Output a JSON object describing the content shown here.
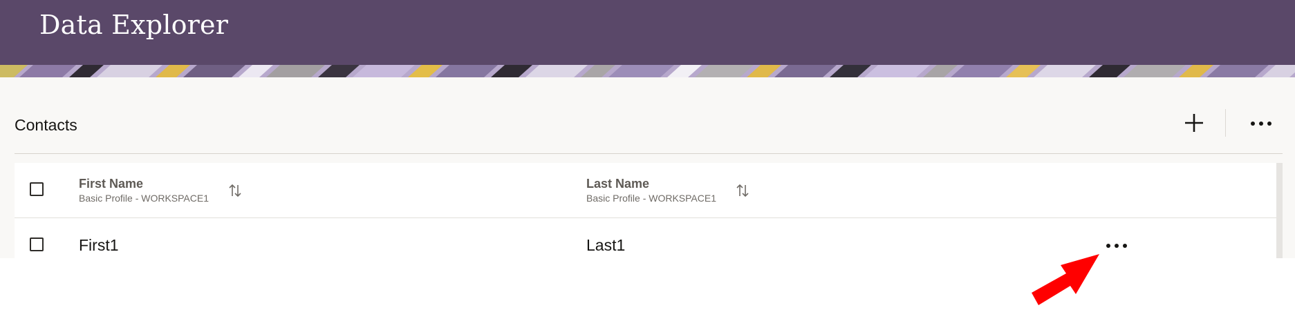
{
  "app": {
    "title": "Data Explorer"
  },
  "section": {
    "title": "Contacts"
  },
  "toolbar": {
    "add_icon": "plus-icon",
    "more_icon": "ellipsis-icon"
  },
  "table": {
    "columns": [
      {
        "title": "First Name",
        "subtitle": "Basic Profile - WORKSPACE1"
      },
      {
        "title": "Last Name",
        "subtitle": "Basic Profile - WORKSPACE1"
      }
    ],
    "rows": [
      {
        "first_name": "First1",
        "last_name": "Last1"
      }
    ]
  },
  "colors": {
    "header_bg": "#5a4869",
    "panel_bg": "#f9f8f6",
    "annotation_arrow": "#ff0000"
  }
}
